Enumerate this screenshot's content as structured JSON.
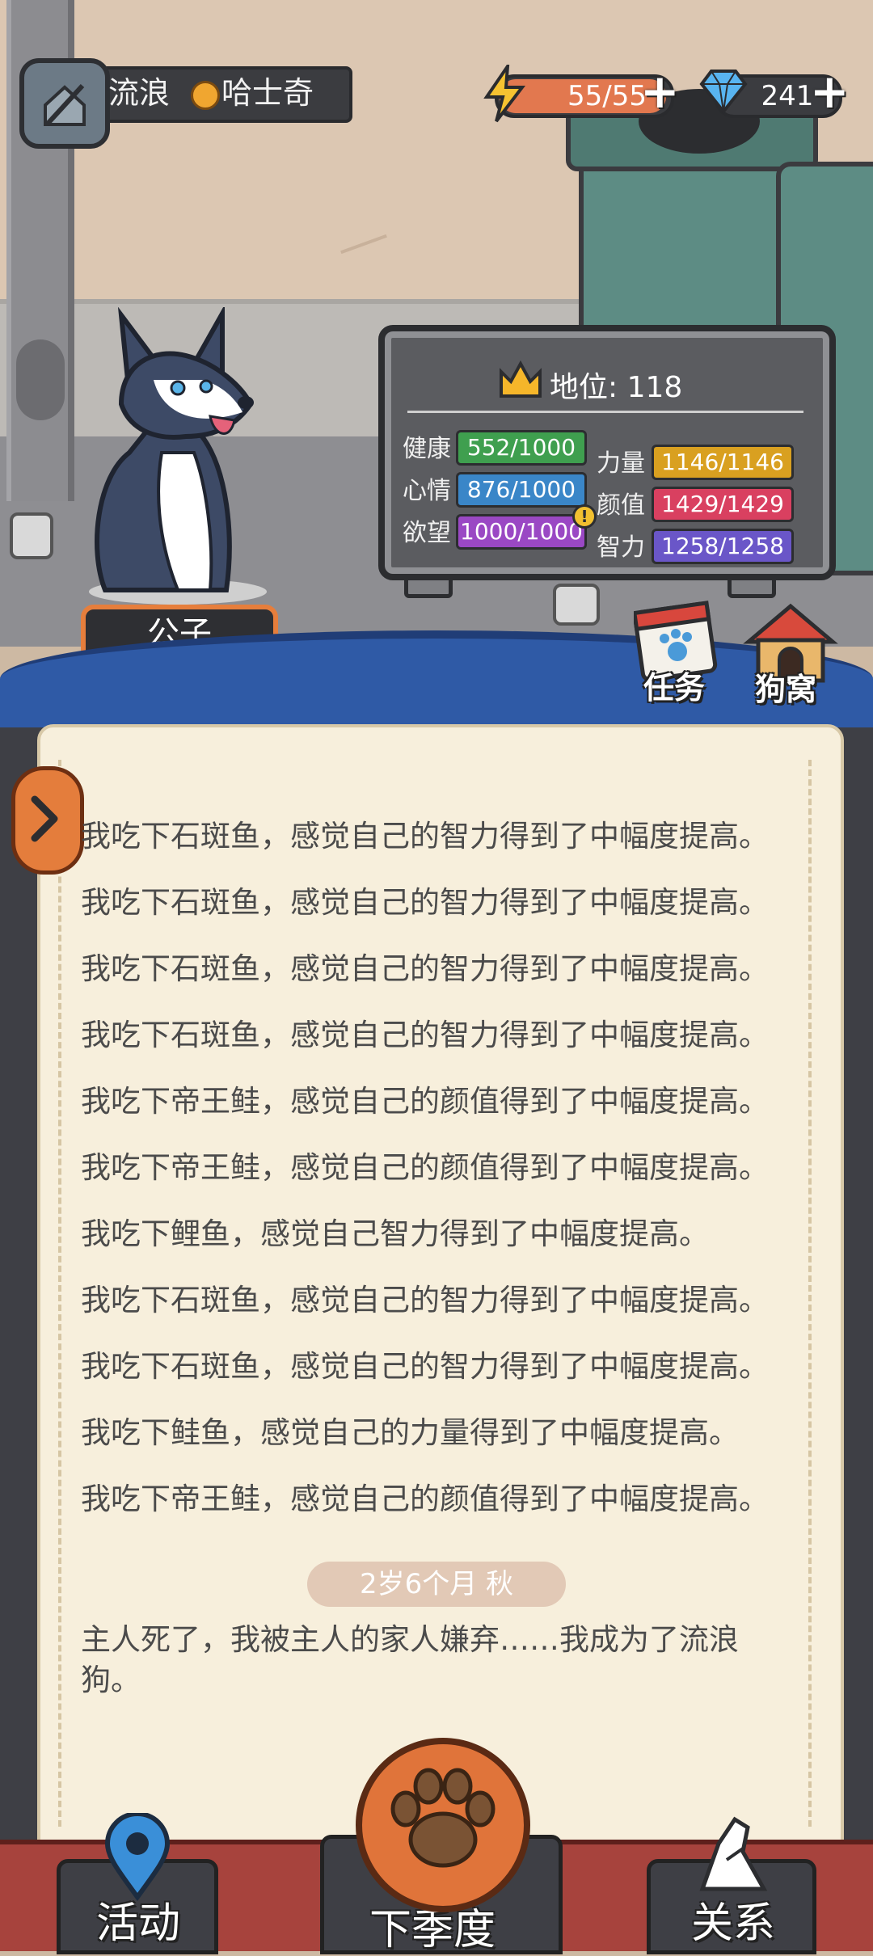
{
  "header": {
    "status": "流浪",
    "breed": "哈士奇",
    "energy": "55/55",
    "energy_fraction": 1.0,
    "gems": "241"
  },
  "dog": {
    "name": "公子"
  },
  "board": {
    "rank_label": "地位: 118",
    "stats": [
      {
        "label": "健康",
        "value": "552/1000",
        "color": "#3f9f4f"
      },
      {
        "label": "力量",
        "value": "1146/1146",
        "color": "#d9a020"
      },
      {
        "label": "心情",
        "value": "876/1000",
        "color": "#3a86c8"
      },
      {
        "label": "颜值",
        "value": "1429/1429",
        "color": "#d94060"
      },
      {
        "label": "欲望",
        "value": "1000/1000",
        "color": "#9a48c4"
      },
      {
        "label": "智力",
        "value": "1258/1258",
        "color": "#6a56c8"
      }
    ]
  },
  "quick": {
    "tasks": "任务",
    "kennel": "狗窝"
  },
  "log": {
    "lines": [
      "我吃下石斑鱼，感觉自己的智力得到了中幅度提高。",
      "我吃下石斑鱼，感觉自己的智力得到了中幅度提高。",
      "我吃下石斑鱼，感觉自己的智力得到了中幅度提高。",
      "我吃下石斑鱼，感觉自己的智力得到了中幅度提高。",
      "我吃下帝王鲑，感觉自己的颜值得到了中幅度提高。",
      "我吃下帝王鲑，感觉自己的颜值得到了中幅度提高。",
      "我吃下鲤鱼，感觉自己智力得到了中幅度提高。",
      "我吃下石斑鱼，感觉自己的智力得到了中幅度提高。",
      "我吃下石斑鱼，感觉自己的智力得到了中幅度提高。",
      "我吃下鲑鱼，感觉自己的力量得到了中幅度提高。",
      "我吃下帝王鲑，感觉自己的颜值得到了中幅度提高。"
    ],
    "season": "2岁6个月 秋",
    "story": "主人死了，我被主人的家人嫌弃……我成为了流浪狗。"
  },
  "nav": {
    "activity": "活动",
    "next_season": "下季度",
    "relations": "关系"
  },
  "icons": {
    "energy": "lightning-icon",
    "gem": "diamond-icon",
    "rank": "crown-icon",
    "tasks": "calendar-paw-icon",
    "kennel": "doghouse-icon",
    "expand": "chevron-right-icon",
    "activity": "map-pin-icon",
    "next": "paw-icon",
    "relations": "handshake-icon"
  }
}
